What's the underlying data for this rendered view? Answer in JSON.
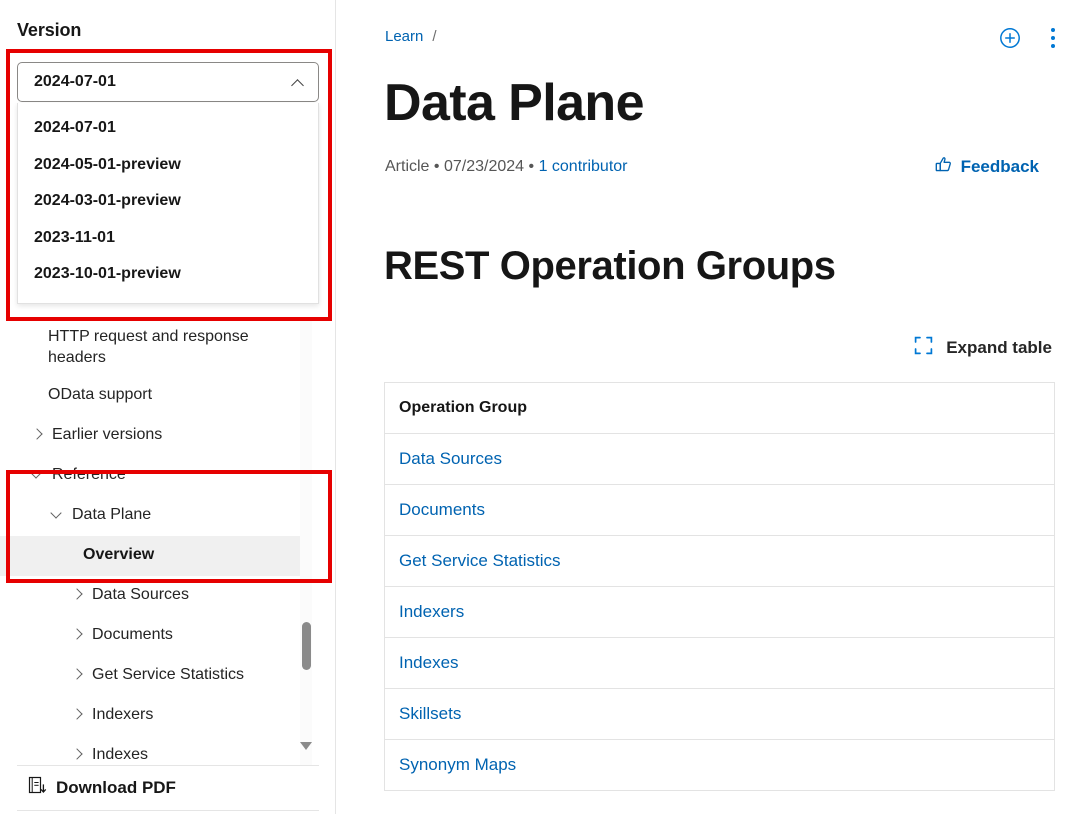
{
  "sidebar": {
    "version_label": "Version",
    "version_selected": "2024-07-01",
    "version_options": [
      "2024-07-01",
      "2024-05-01-preview",
      "2024-03-01-preview",
      "2023-11-01",
      "2023-10-01-preview"
    ],
    "nav_items": [
      {
        "label": "HTTP request and response headers",
        "level": 2,
        "twisty": "none",
        "selected": false
      },
      {
        "label": "OData support",
        "level": 2,
        "twisty": "none",
        "selected": false
      },
      {
        "label": "Earlier versions",
        "level": 1,
        "twisty": "right",
        "selected": false
      },
      {
        "label": "Reference",
        "level": 1,
        "twisty": "down",
        "selected": false
      },
      {
        "label": "Data Plane",
        "level": 2,
        "twisty": "down",
        "selected": false
      },
      {
        "label": "Overview",
        "level": 4,
        "twisty": "none",
        "selected": true
      },
      {
        "label": "Data Sources",
        "level": 3,
        "twisty": "right",
        "selected": false
      },
      {
        "label": "Documents",
        "level": 3,
        "twisty": "right",
        "selected": false
      },
      {
        "label": "Get Service Statistics",
        "level": 3,
        "twisty": "right",
        "selected": false
      },
      {
        "label": "Indexers",
        "level": 3,
        "twisty": "right",
        "selected": false
      },
      {
        "label": "Indexes",
        "level": 3,
        "twisty": "right",
        "selected": false
      }
    ],
    "download_pdf_label": "Download PDF",
    "download_pdf_icon": "pdf-download-icon",
    "scroll_down_icon": "scroll-down-arrow-icon"
  },
  "main": {
    "breadcrumb_root": "Learn",
    "breadcrumb_separator": "/",
    "add_icon": "circle-plus-icon",
    "more_icon": "kebab-menu-icon",
    "title": "Data Plane",
    "meta_type": "Article",
    "meta_dot1": "•",
    "meta_date": "07/23/2024",
    "meta_dot2": "•",
    "meta_contributors": "1 contributor",
    "feedback_label": "Feedback",
    "feedback_icon": "thumbs-up-icon",
    "section_title": "REST Operation Groups",
    "expand_table_label": "Expand table",
    "expand_table_icon": "expand-corners-icon",
    "table": {
      "header": "Operation Group",
      "rows": [
        "Data Sources",
        "Documents",
        "Get Service Statistics",
        "Indexers",
        "Indexes",
        "Skillsets",
        "Synonym Maps"
      ]
    }
  },
  "colors": {
    "link_blue": "#0063b1",
    "accent_blue": "#0078d4",
    "annotation_red": "#e60000",
    "selected_bg": "#f0f0f0"
  }
}
